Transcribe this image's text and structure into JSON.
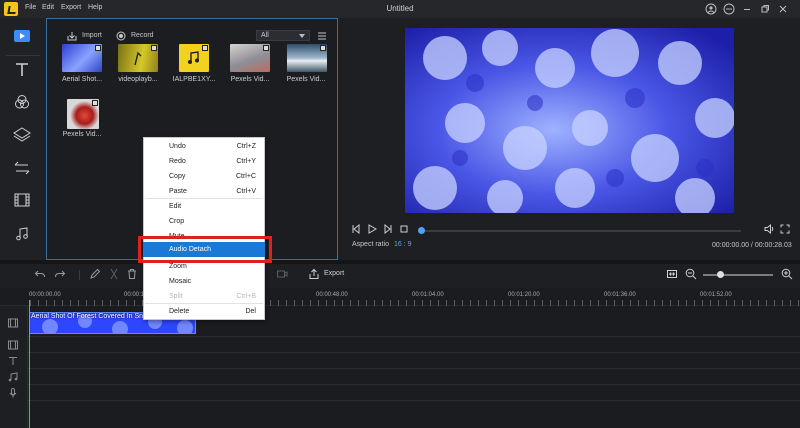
{
  "window": {
    "title": "Untitled",
    "menu": [
      "File",
      "Edit",
      "Export",
      "Help"
    ]
  },
  "sidebar": {
    "items": [
      "media-icon",
      "text-icon",
      "filter-icon",
      "overlay-icon",
      "transition-icon",
      "element-icon",
      "music-icon"
    ]
  },
  "media": {
    "import_label": "Import",
    "record_label": "Record",
    "filter_value": "All",
    "items": [
      {
        "label": "Aerial Shot..."
      },
      {
        "label": "videoplayb..."
      },
      {
        "label": "IALPBE1XY..."
      },
      {
        "label": "Pexels Vid..."
      },
      {
        "label": "Pexels Vid..."
      },
      {
        "label": "Pexels Vid..."
      }
    ]
  },
  "player": {
    "aspect_label": "Aspect ratio",
    "aspect_value": "16 : 9",
    "timecode": "00:00:00.00 / 00:00:28.03",
    "progress": 0.0
  },
  "timeline": {
    "export_label": "Export",
    "ruler": [
      "00:00:00.00",
      "00:00:1",
      "00:00:48.00",
      "00:01:04.00",
      "00:01:20.00",
      "00:01:36.00",
      "00:01:52.00"
    ],
    "clip_label": "Aerial Shot Of Forest Covered In Snow.mp4"
  },
  "context_menu": {
    "items": [
      {
        "label": "Undo",
        "shortcut": "Ctrl+Z",
        "disabled": false
      },
      {
        "label": "Redo",
        "shortcut": "Ctrl+Y",
        "disabled": false
      },
      {
        "label": "Copy",
        "shortcut": "Ctrl+C",
        "disabled": false
      },
      {
        "label": "Paste",
        "shortcut": "Ctrl+V",
        "disabled": false
      },
      {
        "label": "Edit",
        "shortcut": "",
        "disabled": false
      },
      {
        "label": "Crop",
        "shortcut": "",
        "disabled": false
      },
      {
        "label": "Mute",
        "shortcut": "",
        "disabled": false
      },
      {
        "label": "Audio Detach",
        "shortcut": "",
        "disabled": false,
        "highlighted": true
      },
      {
        "label": "Zoom",
        "shortcut": "",
        "disabled": false
      },
      {
        "label": "Mosaic",
        "shortcut": "",
        "disabled": false
      },
      {
        "label": "Split",
        "shortcut": "Ctrl+B",
        "disabled": true
      },
      {
        "label": "Delete",
        "shortcut": "Del",
        "disabled": false
      }
    ]
  },
  "colors": {
    "accent": "#1b79d6",
    "highlight_box": "#e0201d",
    "brand": "#f5c518"
  }
}
